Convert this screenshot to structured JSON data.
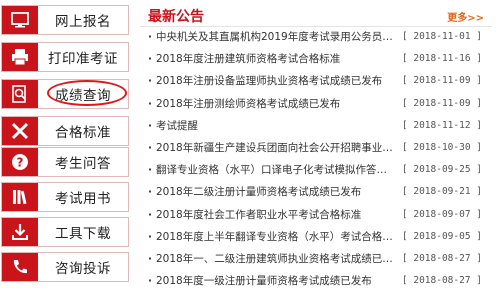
{
  "sidebar": {
    "items": [
      {
        "label": "网上报名",
        "icon": "monitor-icon"
      },
      {
        "label": "打印准考证",
        "icon": "printer-icon"
      },
      {
        "label": "成绩查询",
        "icon": "search-document-icon"
      },
      {
        "label": "合格标准",
        "icon": "ruler-pencil-icon"
      },
      {
        "label": "考生问答",
        "icon": "question-icon"
      },
      {
        "label": "考试用书",
        "icon": "books-icon"
      },
      {
        "label": "工具下载",
        "icon": "download-icon"
      },
      {
        "label": "咨询投诉",
        "icon": "phone-icon"
      }
    ]
  },
  "news": {
    "title": "最新公告",
    "more": "更多>>",
    "items": [
      {
        "title": "中央机关及其直属机构2019年度考试录用公务员照片...",
        "date": "[ 2018-11-01 ]"
      },
      {
        "title": "2018年度注册建筑师资格考试合格标准",
        "date": "[ 2018-11-16 ]"
      },
      {
        "title": "2018年注册设备监理师执业资格考试成绩已发布",
        "date": "[ 2018-11-09 ]"
      },
      {
        "title": "2018年注册测绘师资格考试成绩已发布",
        "date": "[ 2018-11-09 ]"
      },
      {
        "title": "考试提醒",
        "date": "[ 2018-11-12 ]"
      },
      {
        "title": "2018年新疆生产建设兵团面向社会公开招聘事业单位...",
        "date": "[ 2018-10-30 ]"
      },
      {
        "title": "翻译专业资格（水平）口译电子化考试模拟作答系统上线...",
        "date": "[ 2018-09-25 ]"
      },
      {
        "title": "2018年二级注册计量师资格考试成绩已发布",
        "date": "[ 2018-09-21 ]"
      },
      {
        "title": "2018年度社会工作者职业水平考试合格标准",
        "date": "[ 2018-09-07 ]"
      },
      {
        "title": "2018年度上半年翻译专业资格（水平）考试合格标准",
        "date": "[ 2018-09-05 ]"
      },
      {
        "title": "2018年一、二级注册建筑师执业资格考试成绩已发布",
        "date": "[ 2018-08-27 ]"
      },
      {
        "title": "2018年度一级注册计量师资格考试成绩已发布",
        "date": "[ 2018-08-27 ]"
      }
    ]
  },
  "colors": {
    "brand": "#c8141a",
    "more": "#e06a1a",
    "highlight": "#e01818"
  }
}
